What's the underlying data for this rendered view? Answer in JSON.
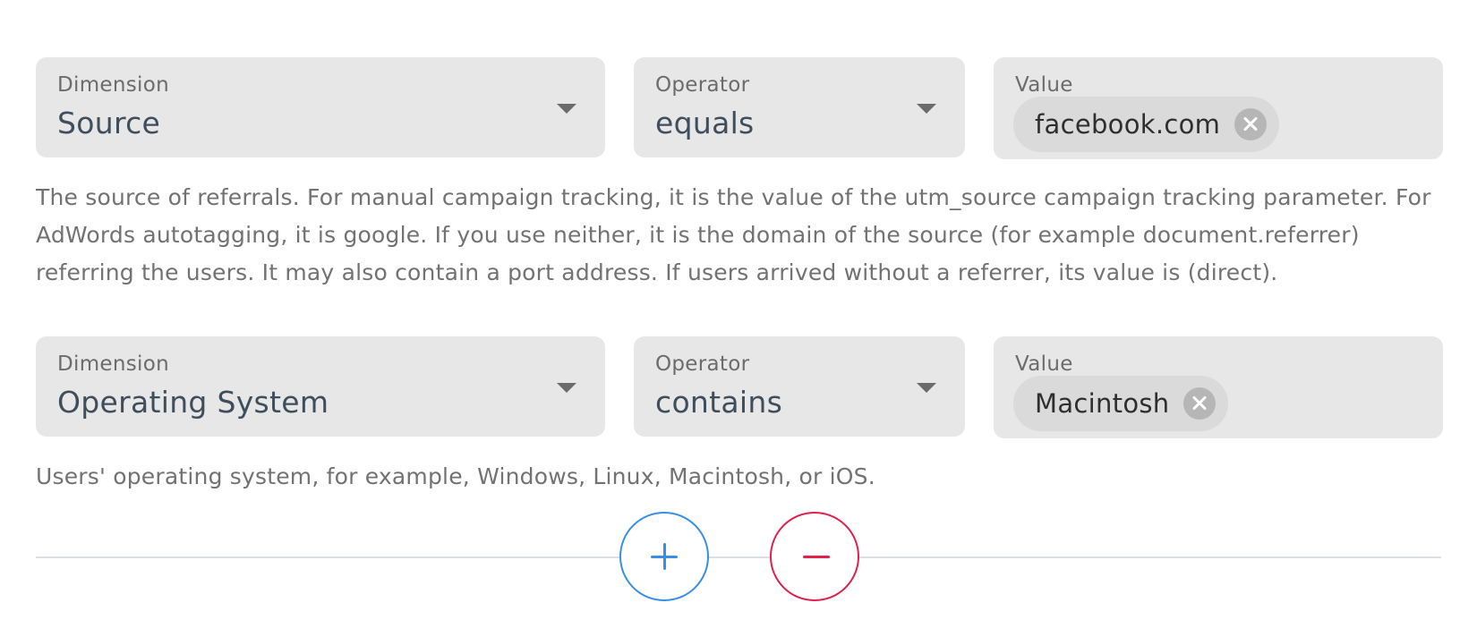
{
  "filters": [
    {
      "dimension_label": "Dimension",
      "dimension_value": "Source",
      "operator_label": "Operator",
      "operator_value": "equals",
      "value_label": "Value",
      "value_chip": "facebook.com",
      "description": "The source of referrals. For manual campaign tracking, it is the value of the utm_source campaign tracking parameter. For AdWords autotagging, it is google. If you use neither, it is the domain of the source (for example document.referrer) referring the users. It may also contain a port address. If users arrived without a referrer, its value is (direct)."
    },
    {
      "dimension_label": "Dimension",
      "dimension_value": "Operating System",
      "operator_label": "Operator",
      "operator_value": "contains",
      "value_label": "Value",
      "value_chip": "Macintosh",
      "description": "Users' operating system, for example, Windows, Linux, Macintosh, or iOS."
    }
  ],
  "actions": {
    "add_icon": "plus-icon",
    "remove_icon": "minus-icon"
  },
  "colors": {
    "field_background": "#e7e7e7",
    "chip_background": "#dadada",
    "add_accent": "#3a8ee6",
    "remove_accent": "#e0204d",
    "label_text": "#6b6b6b",
    "value_text": "#3f4e5c",
    "description_text": "#727272"
  }
}
